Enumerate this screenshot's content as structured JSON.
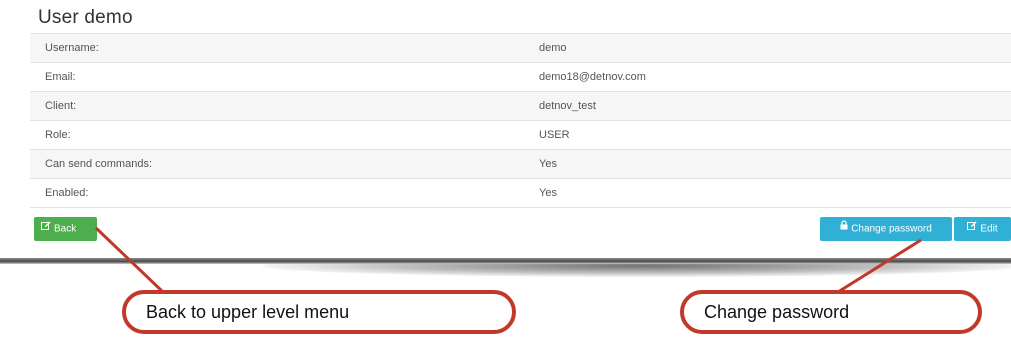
{
  "page": {
    "title": "User demo"
  },
  "details": [
    {
      "label": "Username:",
      "value": "demo"
    },
    {
      "label": "Email:",
      "value": "demo18@detnov.com"
    },
    {
      "label": "Client:",
      "value": "detnov_test"
    },
    {
      "label": "Role:",
      "value": "USER"
    },
    {
      "label": "Can send commands:",
      "value": "Yes"
    },
    {
      "label": "Enabled:",
      "value": "Yes"
    }
  ],
  "actions": {
    "back_label": "Back",
    "back_icon": "edit-icon",
    "change_password_label": "Change password",
    "change_password_icon": "lock-icon",
    "edit_label": "Edit",
    "edit_icon": "edit-icon"
  },
  "annotations": {
    "back": "Back to upper level menu",
    "change_password": "Change password"
  },
  "colors": {
    "back_button": "#4cae4c",
    "info_button": "#31b0d5",
    "callout_border": "#c0392b"
  }
}
